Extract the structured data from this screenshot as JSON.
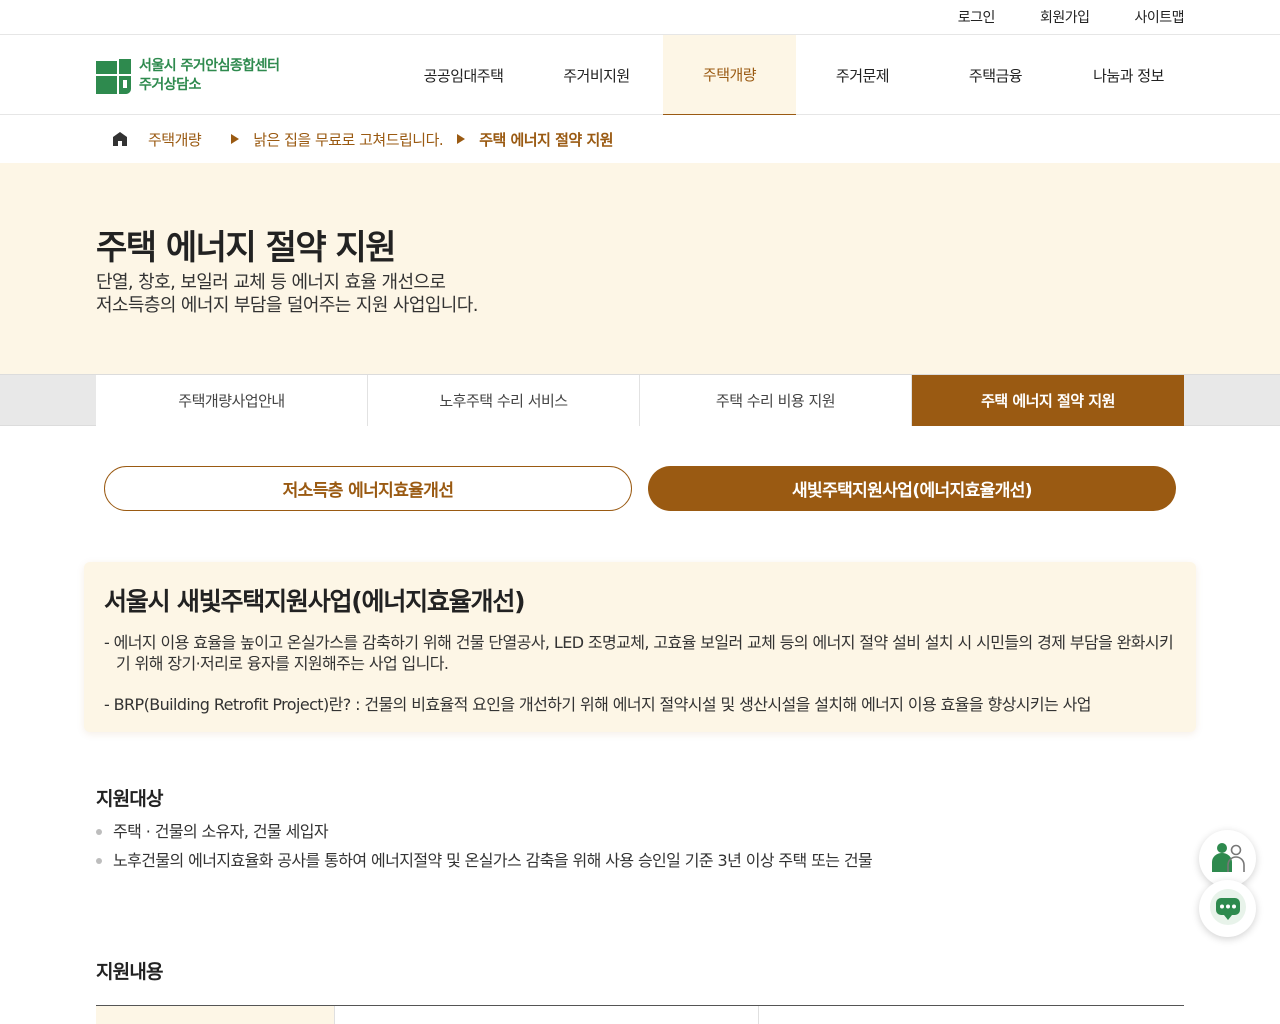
{
  "util": {
    "login": "로그인",
    "signup": "회원가입",
    "sitemap": "사이트맵"
  },
  "logo": {
    "line1": "서울시 주거안심종합센터",
    "line2": "주거상담소",
    "color": "#2e8a4e"
  },
  "gnb": [
    {
      "label": "공공임대주택"
    },
    {
      "label": "주거비지원"
    },
    {
      "label": "주택개량",
      "active": true
    },
    {
      "label": "주거문제"
    },
    {
      "label": "주택금융"
    },
    {
      "label": "나눔과 정보"
    }
  ],
  "breadcrumb": {
    "home_icon": "home-icon",
    "items": [
      "주택개량",
      "낡은 집을 무료로 고쳐드립니다.",
      "주택 에너지 절약 지원"
    ]
  },
  "hero": {
    "title": "주택 에너지 절약 지원",
    "desc_line1": "단열, 창호, 보일러 교체 등 에너지 효율 개선으로",
    "desc_line2": "저소득층의 에너지 부담을 덜어주는 지원 사업입니다."
  },
  "subtabs": [
    {
      "label": "주택개량사업안내"
    },
    {
      "label": "노후주택 수리 서비스"
    },
    {
      "label": "주택 수리 비용 지원"
    },
    {
      "label": "주택 에너지 절약 지원",
      "active": true
    }
  ],
  "pills": {
    "left": "저소득층 에너지효율개선",
    "right": "새빛주택지원사업(에너지효율개선)"
  },
  "intro": {
    "title": "서울시 새빛주택지원사업(에너지효율개선)",
    "p1": "- 에너지 이용 효율을 높이고 온실가스를 감축하기 위해 건물 단열공사, LED 조명교체, 고효율 보일러 교체 등의 에너지 절약 설비 설치 시 시민들의 경제 부담을 완화시키기 위해 장기·저리로 융자를 지원해주는 사업 입니다.",
    "p2": "- BRP(Building Retrofit Project)란? : 건물의 비효율적 요인을 개선하기 위해 에너지 절약시설 및 생산시설을 설치해 에너지 이용 효율을 향상시키는 사업"
  },
  "target": {
    "title": "지원대상",
    "items": [
      "주택 · 건물의 소유자, 건물 세입자",
      "노후건물의 에너지효율화 공사를 통하여 에너지절약 및 온실가스 감축을 위해 사용 승인일 기준 3년 이상 주택 또는 건물"
    ]
  },
  "content": {
    "title": "지원내용"
  },
  "floating": {
    "consult_icon": "counselor-icon",
    "chat_icon": "chatbot-icon"
  },
  "colors": {
    "accent": "#9a5a12",
    "cream": "#fdf6e6",
    "green": "#2e8a4e"
  }
}
